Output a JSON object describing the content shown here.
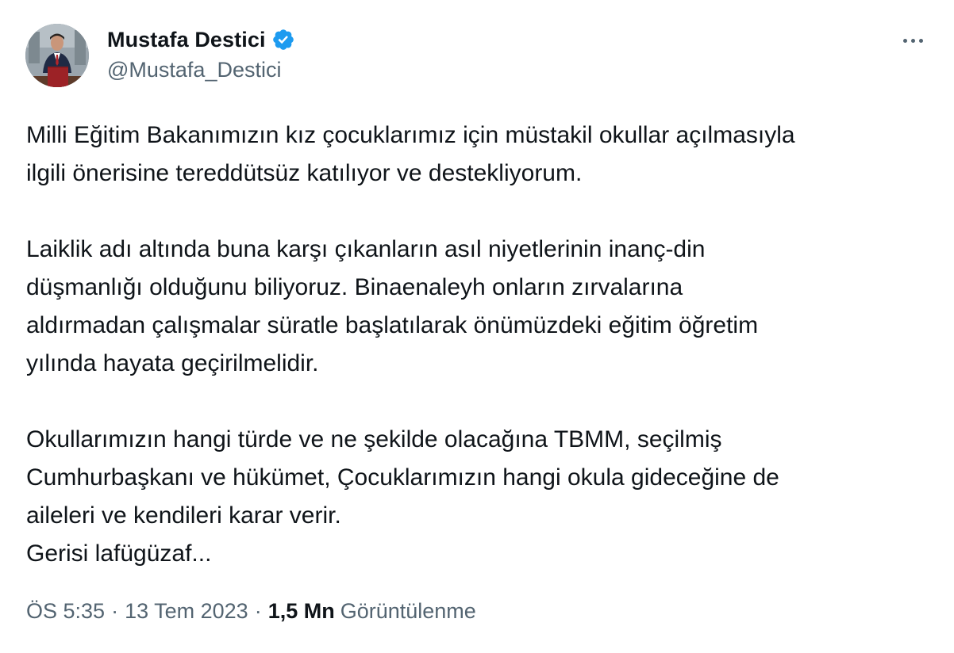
{
  "author": {
    "display_name": "Mustafa Destici",
    "handle": "@Mustafa_Destici",
    "verified_icon": "verified-badge-icon",
    "badge_color": "#1d9bf0"
  },
  "tweet": {
    "paragraphs": [
      "Milli Eğitim Bakanımızın kız çocuklarımız için müstakil okullar açılmasıyla\nilgili önerisine tereddütsüz katılıyor ve destekliyorum.",
      "Laiklik adı altında buna karşı çıkanların asıl niyetlerinin inanç-din\ndüşmanlığı olduğunu biliyoruz. Binaenaleyh onların zırvalarına\naldırmadan çalışmalar süratle başlatılarak önümüzdeki eğitim öğretim\nyılında hayata geçirilmelidir.",
      "Okullarımızın hangi türde ve ne şekilde olacağına TBMM, seçilmiş\nCumhurbaşkanı ve hükümet, Çocuklarımızın hangi okula gideceğine de\naileleri ve kendileri karar verir.\nGerisi lafügüzaf..."
    ]
  },
  "meta": {
    "time": "ÖS 5:35",
    "separator": "·",
    "date": "13 Tem 2023",
    "views_count": "1,5 Mn",
    "views_label": "Görüntülenme"
  },
  "actions": {
    "more_icon": "more-options-icon"
  }
}
